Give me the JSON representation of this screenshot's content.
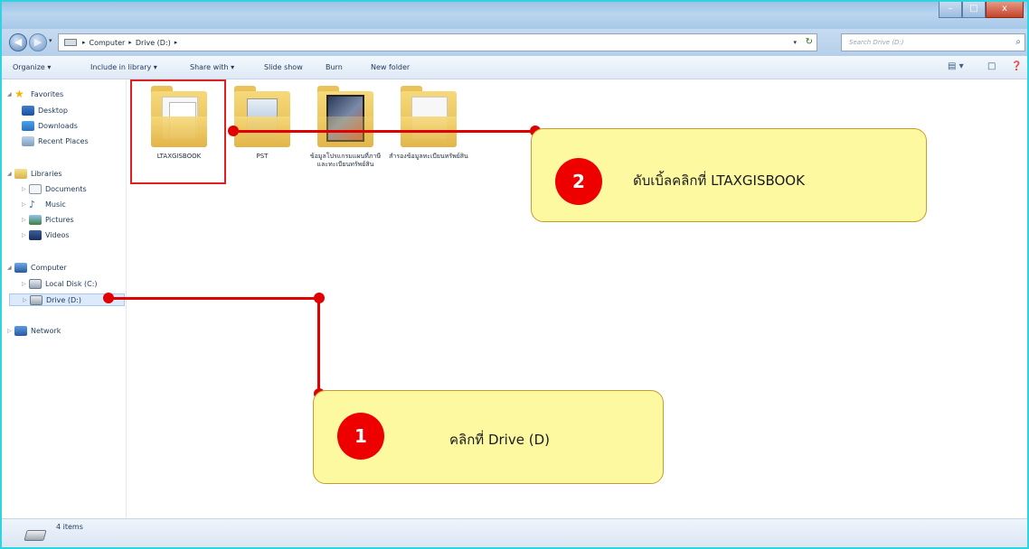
{
  "window": {
    "title": "",
    "controls": {
      "minimize": "–",
      "maximize": "□",
      "close": "x"
    }
  },
  "address": {
    "back_icon": "back-arrow-icon",
    "forward_icon": "forward-arrow-icon",
    "crumbs": [
      "Computer",
      "Drive (D:)"
    ],
    "search_placeholder": "Search Drive (D:)"
  },
  "toolbar": {
    "organize": "Organize ▾",
    "include_in_library": "Include in library ▾",
    "share_with": "Share with ▾",
    "slide_show": "Slide show",
    "burn": "Burn",
    "new_folder": "New folder"
  },
  "navpane": {
    "favorites": "Favorites",
    "desktop": "Desktop",
    "downloads": "Downloads",
    "recent_places": "Recent Places",
    "libraries": "Libraries",
    "documents": "Documents",
    "music": "Music",
    "pictures": "Pictures",
    "videos": "Videos",
    "computer": "Computer",
    "local_disk": "Local Disk (C:)",
    "drive_d": "Drive (D:)",
    "network": "Network"
  },
  "files": [
    {
      "name": "LTAXGISBOOK"
    },
    {
      "name": "PST"
    },
    {
      "name": "ข้อมูลโปรแกรมแผนที่ภาษีและทะเบียนทรัพย์สิน"
    },
    {
      "name": "สำรองข้อมูลทะเบียนทรัพย์สิน"
    }
  ],
  "status": {
    "items": "4 items"
  },
  "annotations": {
    "step1": {
      "number": "1",
      "text": "คลิกที่  Drive (D)"
    },
    "step2": {
      "number": "2",
      "text": "ดับเบิ้ลคลิกที่    LTAXGISBOOK"
    }
  },
  "colors": {
    "frame": "#2fd4e0",
    "callout_fill": "#fdf9a0",
    "badge": "#ee0000",
    "connector": "#e00000"
  }
}
